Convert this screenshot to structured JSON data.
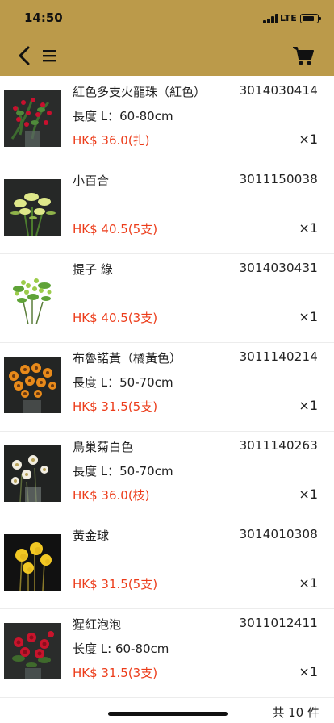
{
  "status_bar": {
    "time": "14:50",
    "network": "LTE"
  },
  "nav": {
    "back_icon": "chevron-left-icon",
    "menu_icon": "hamburger-menu-icon",
    "cart_icon": "shopping-cart-icon"
  },
  "colors": {
    "header": "#bb9a4a",
    "price": "#ec3c1a"
  },
  "items": [
    {
      "name": "紅色多支火龍珠（紅色）",
      "code": "3014030414",
      "length": "長度 L：60-80cm",
      "price": "HK$ 36.0(扎)",
      "qty": "×1"
    },
    {
      "name": "小百合",
      "code": "3011150038",
      "length": "",
      "price": "HK$ 40.5(5支)",
      "qty": "×1"
    },
    {
      "name": "提子 綠",
      "code": "3014030431",
      "length": "",
      "price": "HK$ 40.5(3支)",
      "qty": "×1"
    },
    {
      "name": "布魯諾黃（橘黃色）",
      "code": "3011140214",
      "length": "長度 L：50-70cm",
      "price": "HK$ 31.5(5支)",
      "qty": "×1"
    },
    {
      "name": "鳥巢菊白色",
      "code": "3011140263",
      "length": "長度 L：50-70cm",
      "price": "HK$ 36.0(枝)",
      "qty": "×1"
    },
    {
      "name": "黃金球",
      "code": "3014010308",
      "length": "",
      "price": "HK$ 31.5(5支)",
      "qty": "×1"
    },
    {
      "name": "猩紅泡泡",
      "code": "3011012411",
      "length": "长度 L: 60-80cm",
      "price": "HK$ 31.5(3支)",
      "qty": "×1"
    }
  ],
  "footer": {
    "total": "共 10 件"
  }
}
